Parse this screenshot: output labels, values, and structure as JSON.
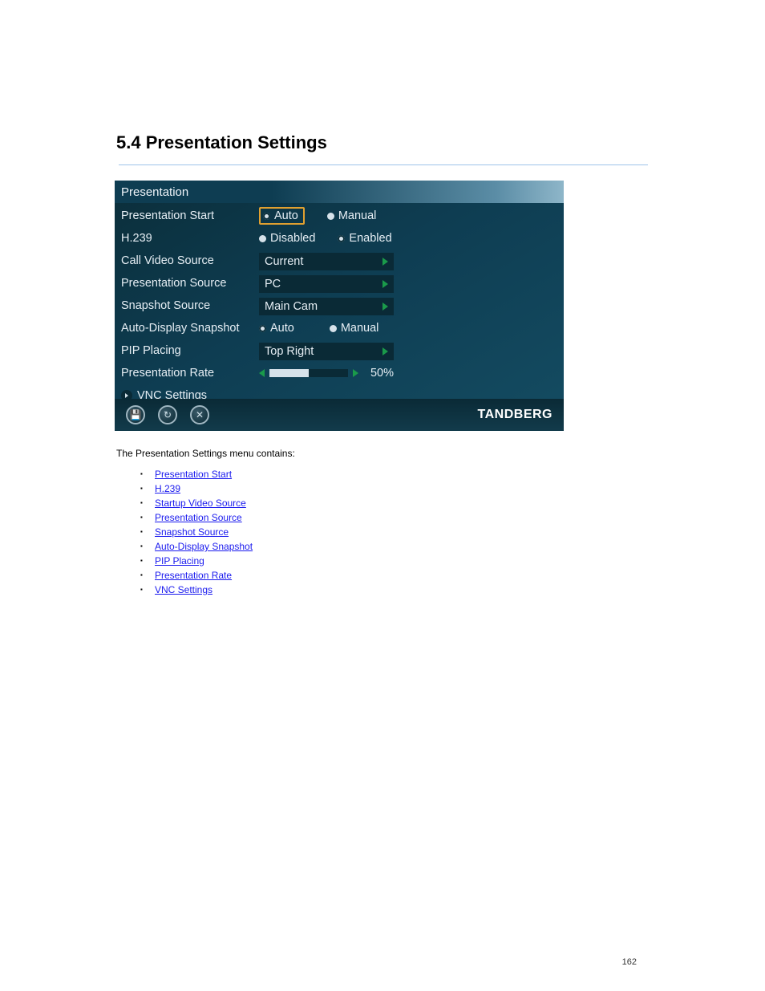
{
  "section_title": "5.4 Presentation Settings",
  "panel": {
    "title": "Presentation",
    "rows": {
      "presentation_start": {
        "label": "Presentation Start",
        "options": [
          "Auto",
          "Manual"
        ],
        "selected": "Auto",
        "highlight": true
      },
      "h239": {
        "label": "H.239",
        "options": [
          "Disabled",
          "Enabled"
        ],
        "selected": "Enabled"
      },
      "call_video_source": {
        "label": "Call Video Source",
        "value": "Current"
      },
      "presentation_source": {
        "label": "Presentation Source",
        "value": "PC"
      },
      "snapshot_source": {
        "label": "Snapshot Source",
        "value": "Main Cam"
      },
      "auto_display": {
        "label": "Auto-Display Snapshot",
        "options": [
          "Auto",
          "Manual"
        ],
        "selected": "Auto"
      },
      "pip_placing": {
        "label": "PIP Placing",
        "value": "Top Right"
      },
      "presentation_rate": {
        "label": "Presentation Rate",
        "value": "50%",
        "fill_pct": 50
      },
      "vnc": {
        "label": "VNC Settings"
      }
    },
    "footer_brand": "TANDBERG"
  },
  "body": {
    "intro": "The Presentation Settings menu contains:",
    "links": [
      "Presentation Start",
      "H.239",
      "Startup Video Source",
      "Presentation Source",
      "Snapshot Source",
      "Auto-Display Snapshot",
      "PIP Placing",
      "Presentation Rate",
      "VNC Settings"
    ]
  },
  "page_number": "162"
}
